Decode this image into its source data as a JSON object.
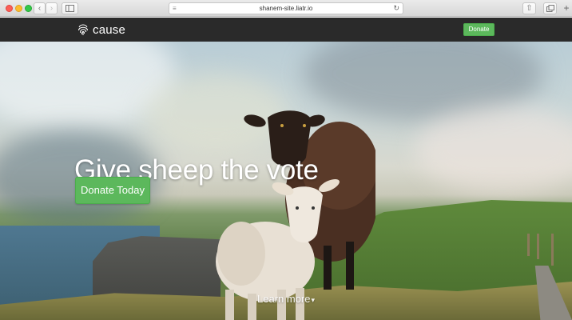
{
  "browser": {
    "url": "shanem-site.liatr.io",
    "back_icon": "chevron-left-icon",
    "forward_icon": "chevron-right-icon",
    "sidebar_icon": "sidebar-icon",
    "reload_icon": "reload-icon",
    "share_icon": "share-icon",
    "tabs_icon": "tabs-icon",
    "new_tab_icon": "plus-icon"
  },
  "nav": {
    "brand": "cause",
    "logo_icon": "fingerprint-icon",
    "donate_label": "Donate"
  },
  "hero": {
    "headline": "Give sheep the vote",
    "cta_label": "Donate Today",
    "learn_more": "Learn more",
    "learn_more_icon": "caret-down-icon"
  },
  "colors": {
    "nav_bg": "#2a2a2a",
    "button_green": "#5cb85c"
  }
}
